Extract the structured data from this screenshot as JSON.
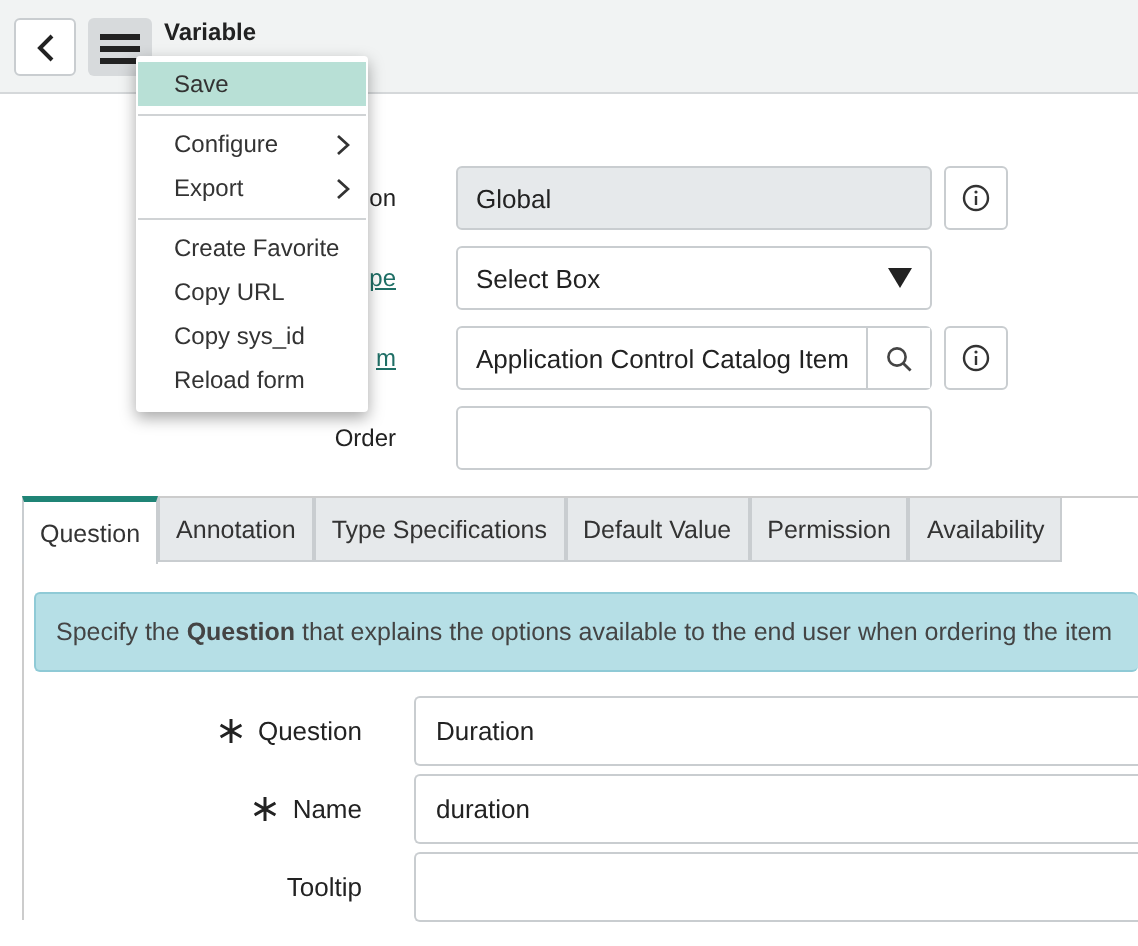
{
  "header": {
    "title": "Variable"
  },
  "menu": {
    "items": [
      {
        "label": "Save",
        "selected": true,
        "submenu": false,
        "divider_before": false
      },
      {
        "label": "Configure",
        "selected": false,
        "submenu": true,
        "divider_before": true
      },
      {
        "label": "Export",
        "selected": false,
        "submenu": true,
        "divider_before": false
      },
      {
        "label": "Create Favorite",
        "selected": false,
        "submenu": false,
        "divider_before": true
      },
      {
        "label": "Copy URL",
        "selected": false,
        "submenu": false,
        "divider_before": false
      },
      {
        "label": "Copy sys_id",
        "selected": false,
        "submenu": false,
        "divider_before": false
      },
      {
        "label": "Reload form",
        "selected": false,
        "submenu": false,
        "divider_before": false
      }
    ]
  },
  "form": {
    "fields": [
      {
        "label": "on",
        "link": false,
        "kind": "readonly",
        "value": "Global",
        "info": true
      },
      {
        "label": "pe",
        "link": true,
        "kind": "select",
        "value": "Select Box",
        "info": false
      },
      {
        "label": "m",
        "link": true,
        "kind": "reference",
        "value": "Application Control Catalog Item",
        "info": true
      },
      {
        "label": "Order",
        "link": false,
        "kind": "text",
        "info": false
      }
    ]
  },
  "tabs": [
    {
      "label": "Question",
      "selected": true
    },
    {
      "label": "Annotation",
      "selected": false
    },
    {
      "label": "Type Specifications",
      "selected": false
    },
    {
      "label": "Default Value",
      "selected": false
    },
    {
      "label": "Permission",
      "selected": false
    },
    {
      "label": "Availability",
      "selected": false
    }
  ],
  "banner": "Specify the **Question** that explains the options available to the end user when ordering the item",
  "question_fields": [
    {
      "label": "Question",
      "mandatory": true,
      "value": "Duration"
    },
    {
      "label": "Name",
      "mandatory": true,
      "value": "duration"
    },
    {
      "label": "Tooltip",
      "mandatory": false
    }
  ]
}
